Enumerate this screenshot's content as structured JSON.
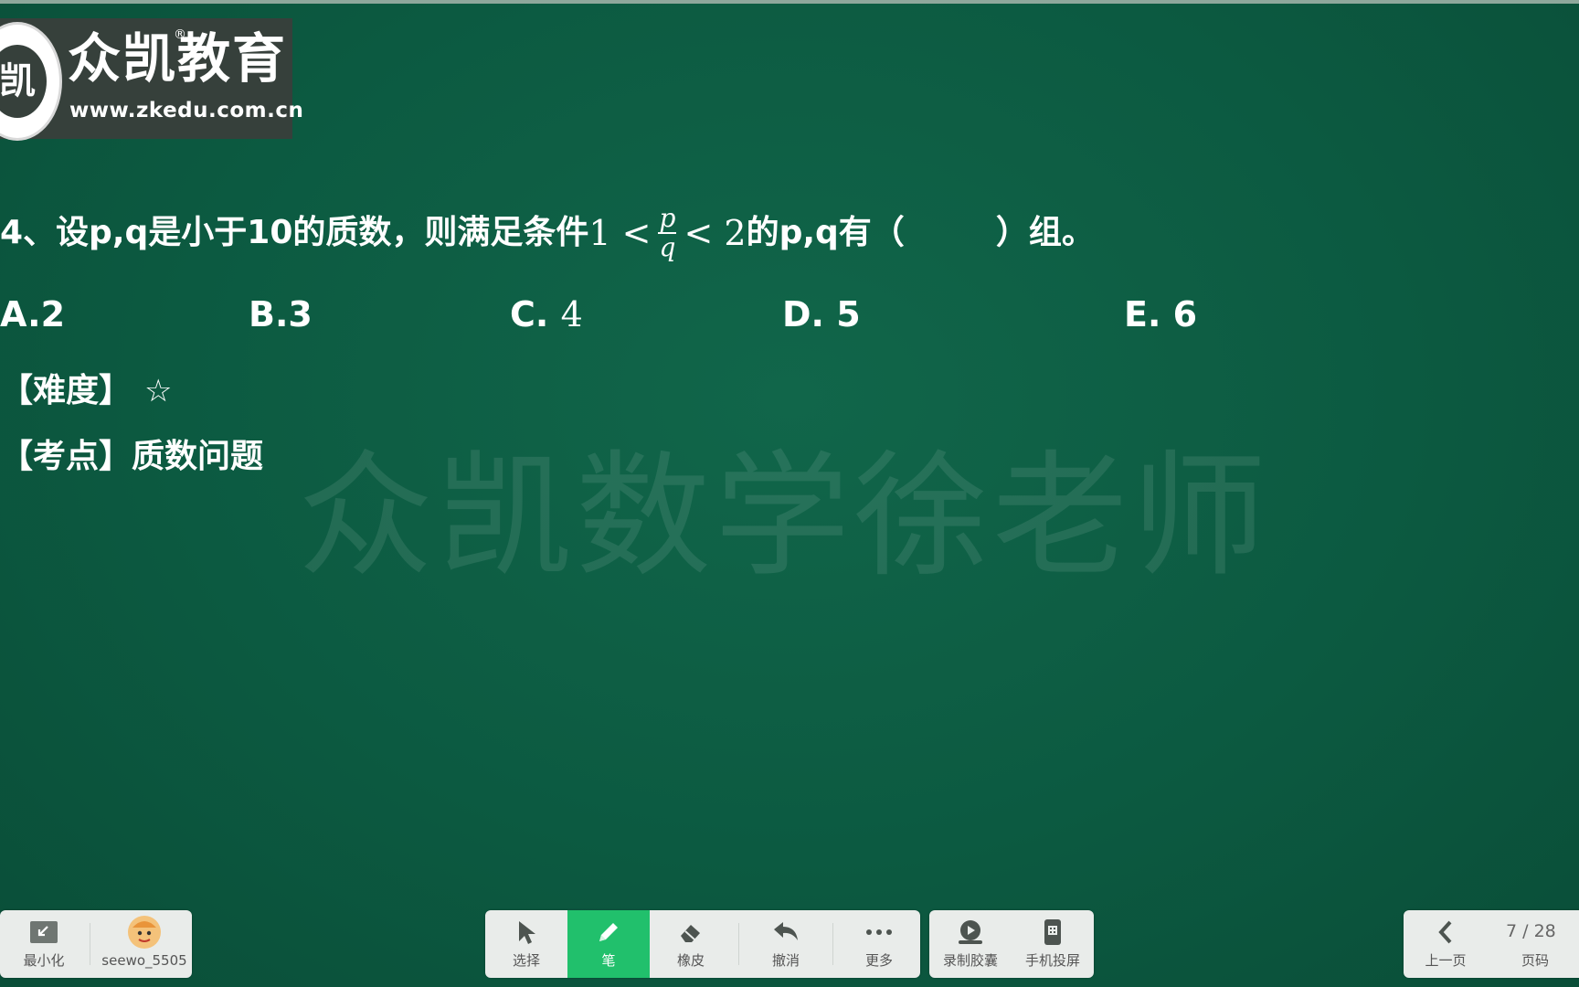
{
  "logo": {
    "seal_char": "凯",
    "brand_name": "众凯教育",
    "registered": "®",
    "url": "www.zkedu.com.cn"
  },
  "watermark": "众凯数学徐老师",
  "question": {
    "prefix": "4、设p,q是小于10的质数，则满足条件",
    "ineq_left": "1 <",
    "numerator": "p",
    "denominator": "q",
    "ineq_right": "< 2",
    "suffix_open": "的p,q有（",
    "suffix_close": "）组。"
  },
  "options": [
    {
      "label": "A.",
      "value": "2"
    },
    {
      "label": "B.",
      "value": "3"
    },
    {
      "label": "C.",
      "value": "4"
    },
    {
      "label": "D.",
      "value": "5"
    },
    {
      "label": "E.",
      "value": "6"
    }
  ],
  "difficulty": {
    "label": "【难度】",
    "stars": "☆"
  },
  "topic": {
    "label": "【考点】",
    "value": "质数问题"
  },
  "toolbar": {
    "minimize": "最小化",
    "user": "seewo_5505",
    "select": "选择",
    "pen": "笔",
    "eraser": "橡皮",
    "undo": "撤消",
    "more": "更多",
    "record": "录制胶囊",
    "cast": "手机投屏",
    "prev_page": "上一页",
    "page_label": "页码",
    "page_current": "7 / 28"
  },
  "colors": {
    "board": "#0e5a41",
    "active_tool": "#21c06c",
    "toolbar_bg": "#e9ecea"
  }
}
